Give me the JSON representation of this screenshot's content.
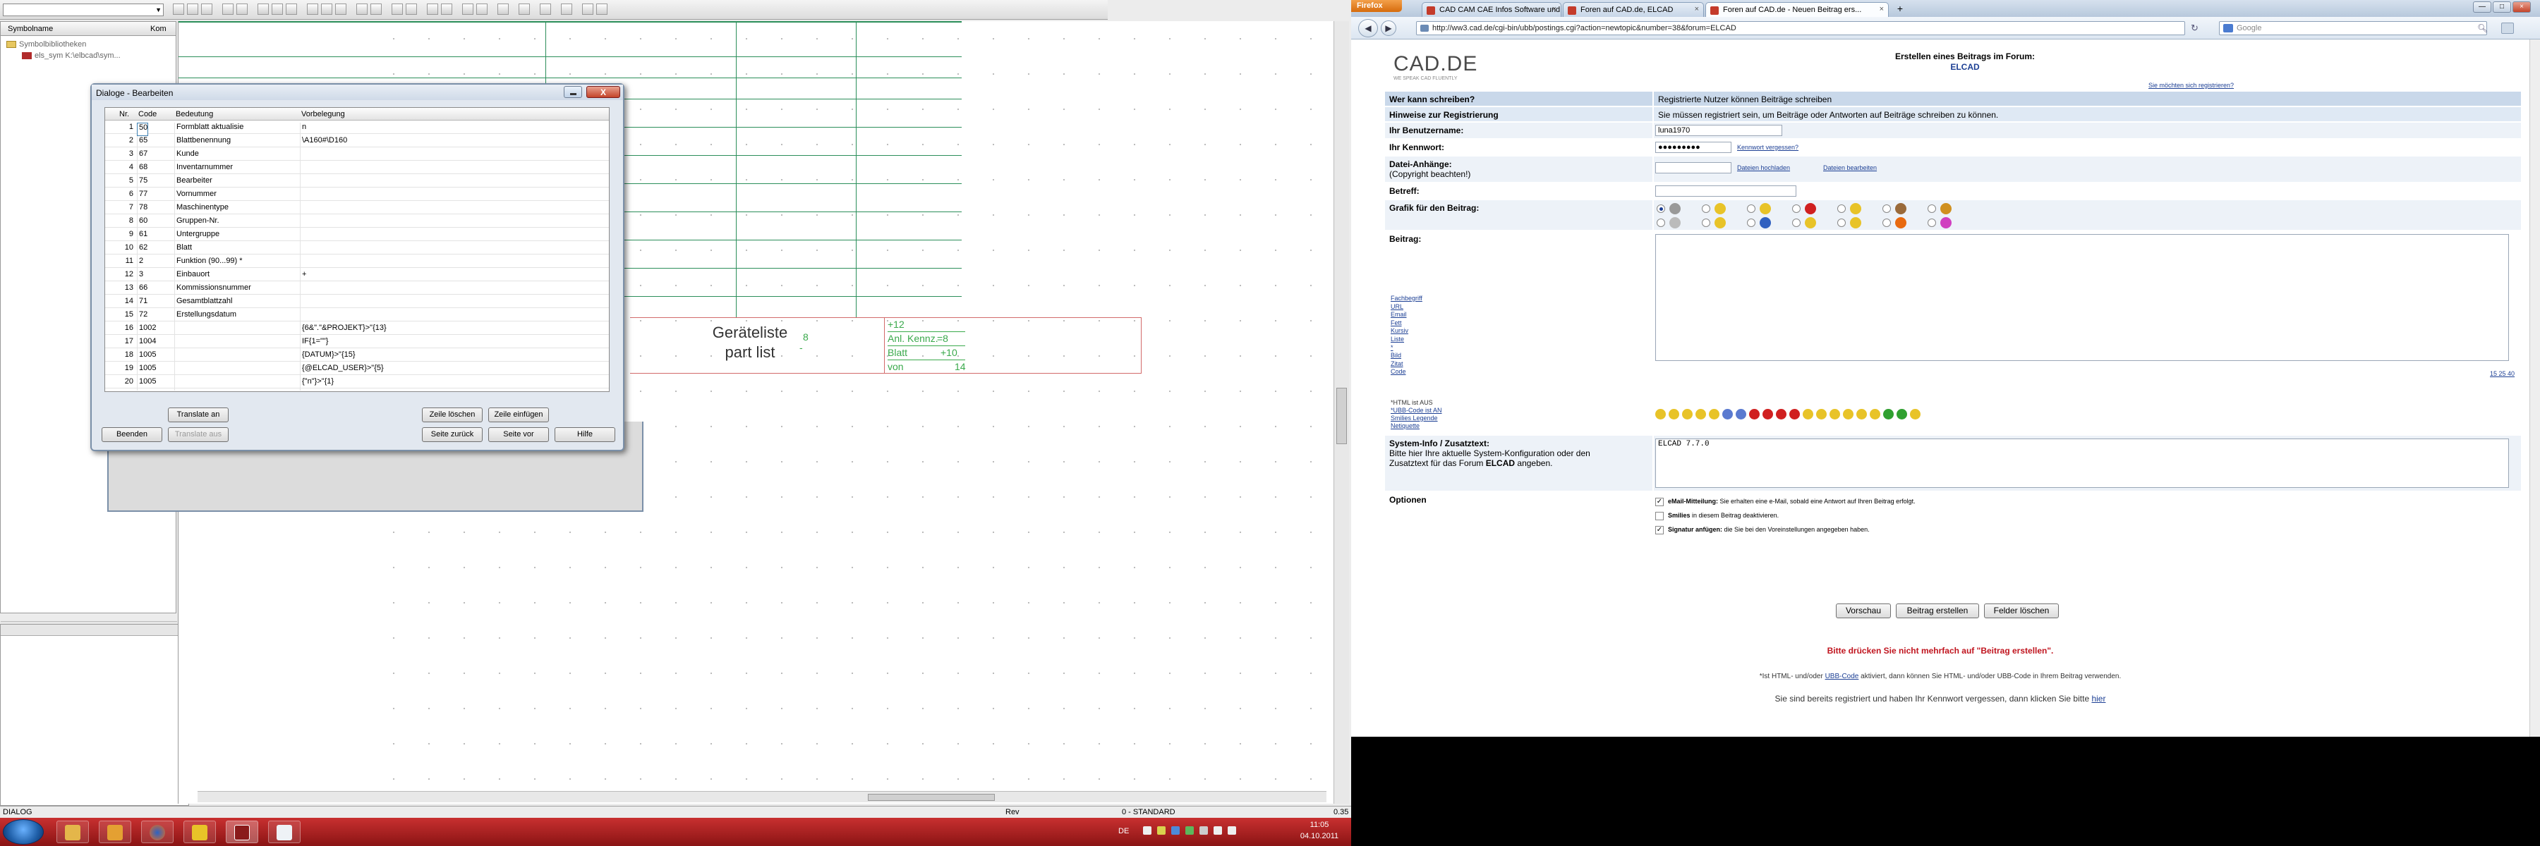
{
  "cad": {
    "symbol_panel": {
      "col_name": "Symbolname",
      "col_comment": "Kom",
      "tree": [
        {
          "label": "Symbolbibliotheken"
        },
        {
          "label": "els_sym   K:\\elbcad\\sym..."
        }
      ]
    },
    "drawing": {
      "legend_title_line1": "Geräteliste",
      "legend_title_line2": "part list",
      "legend_num": "8",
      "legend_dash": "-",
      "legend_rows": [
        {
          "label": "+12",
          "value": ""
        },
        {
          "label": "Anl. Kennz.",
          "value": "=8"
        },
        {
          "label": "Blatt",
          "value": "+10"
        },
        {
          "label": "von",
          "value": "14"
        }
      ]
    },
    "status": {
      "left": "DIALOG",
      "rev": "Rev",
      "layer": "0 - STANDARD",
      "zoom": "0.35"
    }
  },
  "dialog": {
    "title": "Dialoge - Bearbeiten",
    "close_symbol": "X",
    "columns": {
      "nr": "Nr.",
      "code": "Code",
      "bedeutung": "Bedeutung",
      "vorbelegung": "Vorbelegung"
    },
    "rows": [
      {
        "nr": "1",
        "code": "50",
        "bed": "Formblatt aktualisie",
        "vor": "n"
      },
      {
        "nr": "2",
        "code": "65",
        "bed": "Blattbenennung",
        "vor": "\\A160#\\D160"
      },
      {
        "nr": "3",
        "code": "67",
        "bed": "Kunde",
        "vor": ""
      },
      {
        "nr": "4",
        "code": "68",
        "bed": "Inventarnummer",
        "vor": ""
      },
      {
        "nr": "5",
        "code": "75",
        "bed": "Bearbeiter",
        "vor": ""
      },
      {
        "nr": "6",
        "code": "77",
        "bed": "Vornummer",
        "vor": ""
      },
      {
        "nr": "7",
        "code": "78",
        "bed": "Maschinentype",
        "vor": ""
      },
      {
        "nr": "8",
        "code": "60",
        "bed": "Gruppen-Nr.",
        "vor": ""
      },
      {
        "nr": "9",
        "code": "61",
        "bed": "Untergruppe",
        "vor": ""
      },
      {
        "nr": "10",
        "code": "62",
        "bed": "Blatt",
        "vor": ""
      },
      {
        "nr": "11",
        "code": "2",
        "bed": "Funktion (90...99)  *",
        "vor": ""
      },
      {
        "nr": "12",
        "code": "3",
        "bed": "Einbauort",
        "vor": "+"
      },
      {
        "nr": "13",
        "code": "66",
        "bed": "Kommissionsnummer",
        "vor": ""
      },
      {
        "nr": "14",
        "code": "71",
        "bed": "Gesamtblattzahl",
        "vor": ""
      },
      {
        "nr": "15",
        "code": "72",
        "bed": "Erstellungsdatum",
        "vor": ""
      },
      {
        "nr": "16",
        "code": "1002",
        "bed": "",
        "vor": "{6&\".\"&PROJEKT}>\"{13}"
      },
      {
        "nr": "17",
        "code": "1004",
        "bed": "",
        "vor": "IF{1=\"\"}"
      },
      {
        "nr": "18",
        "code": "1005",
        "bed": "",
        "vor": "{DATUM}>\"{15}"
      },
      {
        "nr": "19",
        "code": "1005",
        "bed": "",
        "vor": "{@ELCAD_USER}>\"{5}"
      },
      {
        "nr": "20",
        "code": "1005",
        "bed": "",
        "vor": "{\"n\"}>\"{1}"
      }
    ],
    "buttons": {
      "translate_an": "Translate an",
      "zeile_loeschen": "Zeile löschen",
      "zeile_einfuegen": "Zeile einfügen",
      "beenden": "Beenden",
      "translate_aus": "Translate aus",
      "seite_zurueck": "Seite zurück",
      "seite_vor": "Seite vor",
      "hilfe": "Hilfe"
    }
  },
  "taskbar": {
    "lang": "DE",
    "time": "11:05",
    "date": "04.10.2011"
  },
  "browser": {
    "firefox_label": "Firefox",
    "tabs": [
      {
        "label": "CAD CAM CAE Infos Software und Fo...",
        "color": "#c43b2b"
      },
      {
        "label": "Foren auf CAD.de, ELCAD",
        "color": "#c43b2b"
      },
      {
        "label": "Foren auf CAD.de - Neuen Beitrag ers...",
        "color": "#c43b2b"
      }
    ],
    "new_tab": "+",
    "url": "http://ww3.cad.de/cgi-bin/ubb/postings.cgi?action=newtopic&number=38&forum=ELCAD",
    "search_placeholder": "Google",
    "page": {
      "logo": "CAD.DE",
      "logo_sub": "WE SPEAK CAD FLUENTLY",
      "header_line1": "Erstellen eines Beitrags im Forum:",
      "header_forum": "ELCAD",
      "register_link": "Sie möchten sich registrieren?",
      "who_label": "Wer kann schreiben?",
      "who_value": "Registrierte Nutzer können Beiträge schreiben",
      "hint_label": "Hinweise zur Registrierung",
      "hint_value": "Sie müssen registriert sein, um Beiträge oder Antworten auf Beiträge schreiben zu können.",
      "username_label": "Ihr Benutzername:",
      "username_value": "luna1970",
      "password_label": "Ihr Kennwort:",
      "password_value": "●●●●●●●●●",
      "password_forgot": "Kennwort vergessen?",
      "attach_label_1": "Datei-Anhänge:",
      "attach_label_2": "(Copyright beachten!)",
      "attach_upload": "Dateien hochladen",
      "attach_edit": "Dateien bearbeiten",
      "subject_label": "Betreff:",
      "graphic_label": "Grafik für den Beitrag:",
      "body_label": "Beitrag:",
      "format_links": [
        "Fachbegriff",
        "URL",
        "Email",
        "Fett",
        "Kursiv",
        "Liste",
        "*",
        "Bild",
        "Zitat",
        "Code"
      ],
      "html_status": "*HTML ist AUS",
      "ubb_status": "*UBB-Code ist AN",
      "smilies_legend": "Smilies Legende",
      "netiquette": "Netiquette",
      "size_links": "15 25 40",
      "sysinfo_label": "System-Info / Zusatztext:",
      "sysinfo_desc_1": "Bitte hier Ihre aktuelle System-Konfiguration oder den",
      "sysinfo_desc_2": "Zusatztext für das Forum ",
      "sysinfo_desc_forum": "ELCAD",
      "sysinfo_desc_3": " angeben.",
      "sysinfo_value": "ELCAD 7.7.0",
      "options_label": "Optionen",
      "opt1_bold": "eMail-Mitteilung:",
      "opt1_text": " Sie erhalten eine e-Mail, sobald eine Antwort auf Ihren Beitrag erfolgt.",
      "opt2_bold": "Smilies",
      "opt2_text": " in diesem Beitrag deaktivieren.",
      "opt3_bold": "Signatur anfügen:",
      "opt3_text": " die Sie bei den Voreinstellungen angegeben haben.",
      "btn_preview": "Vorschau",
      "btn_submit": "Beitrag erstellen",
      "btn_clear": "Felder löschen",
      "warning": "Bitte drücken Sie nicht mehrfach auf \"Beitrag erstellen\".",
      "note_1": "*Ist HTML- und/oder ",
      "note_ubb": "UBB-Code",
      "note_2": " aktiviert, dann können Sie HTML- und/oder UBB-Code in Ihrem Beitrag verwenden.",
      "forgot_1": "Sie sind bereits registriert und haben Ihr Kennwort vergessen, dann klicken Sie bitte ",
      "forgot_link": "hier"
    }
  }
}
